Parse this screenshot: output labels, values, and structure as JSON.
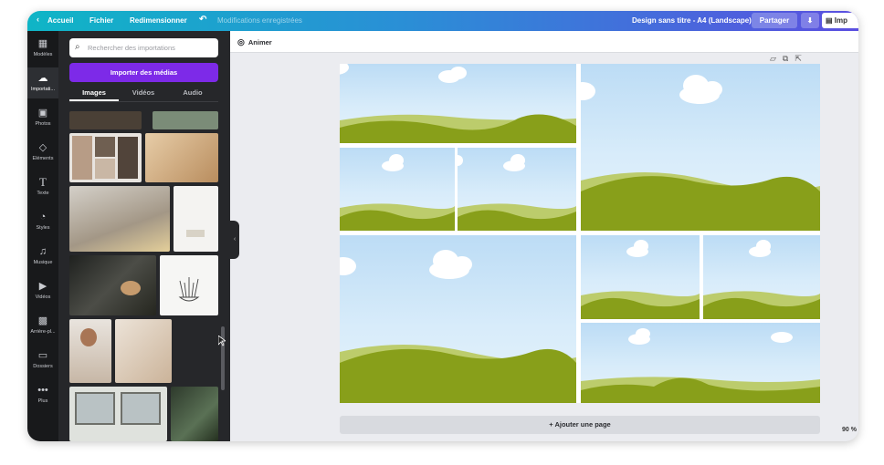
{
  "topbar": {
    "home": "Accueil",
    "file": "Fichier",
    "resize": "Redimensionner",
    "status": "Modifications enregistrées",
    "doc_title": "Design sans titre - A4 (Landscape)",
    "share": "Partager",
    "print": "Imp"
  },
  "rail": [
    {
      "label": "Modèles",
      "icon": "templates-icon"
    },
    {
      "label": "Importati...",
      "icon": "upload-icon"
    },
    {
      "label": "Photos",
      "icon": "photos-icon"
    },
    {
      "label": "Éléments",
      "icon": "elements-icon"
    },
    {
      "label": "Texte",
      "icon": "text-icon"
    },
    {
      "label": "Styles",
      "icon": "styles-icon"
    },
    {
      "label": "Musique",
      "icon": "music-icon"
    },
    {
      "label": "Vidéos",
      "icon": "videos-icon"
    },
    {
      "label": "Arrière-pl...",
      "icon": "background-icon"
    },
    {
      "label": "Dossiers",
      "icon": "folders-icon"
    },
    {
      "label": "Plus",
      "icon": "more-icon"
    }
  ],
  "panel": {
    "search_placeholder": "Rechercher des importations",
    "import_button": "Importer des médias",
    "tabs": [
      "Images",
      "Vidéos",
      "Audio"
    ]
  },
  "canvas": {
    "animate": "Animer",
    "add_page": "+ Ajouter une page",
    "zoom": "90 %"
  },
  "colors": {
    "accent": "#7d2ae8",
    "sky": "#c5e2f6",
    "hill_dark": "#889f1a",
    "hill_light": "#bccc6c"
  }
}
